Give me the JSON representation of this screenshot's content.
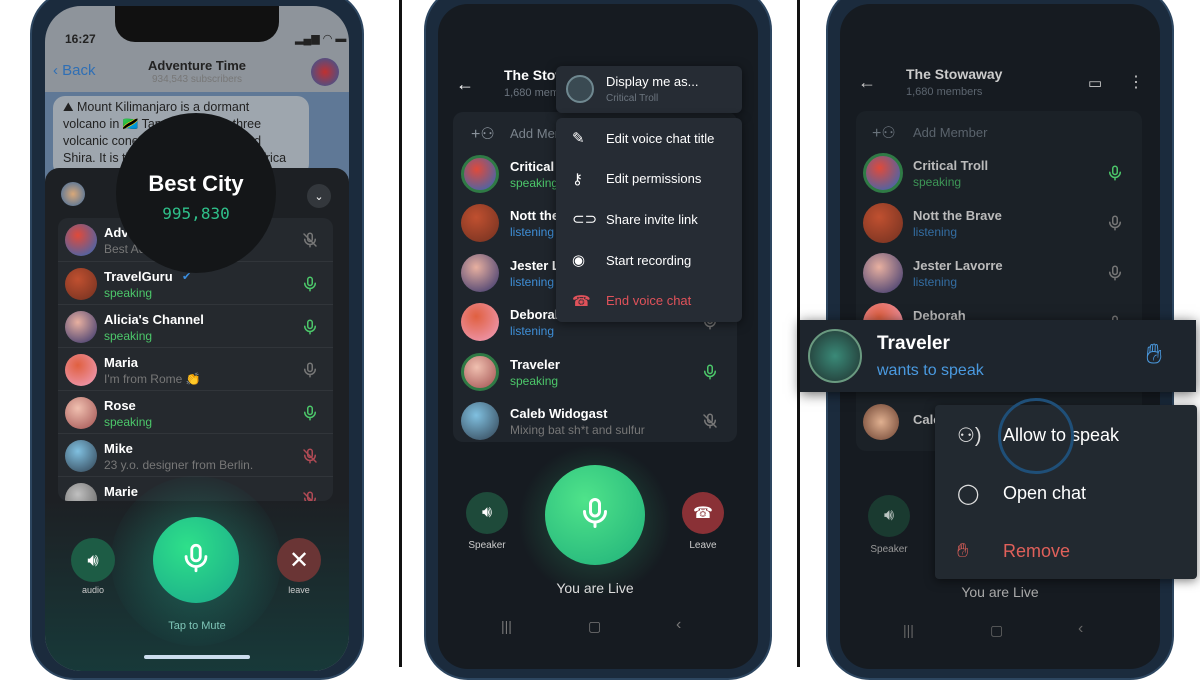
{
  "colors": {
    "green": "#4cc76a",
    "blue": "#3e8ed6",
    "red": "#e0525a",
    "sheet": "#1c1f23",
    "android_bg": "#171c22"
  },
  "panel1": {
    "status_time": "16:27",
    "back_label": "Back",
    "title": "Adventure Time",
    "subtitle": "934,543 subscribers",
    "message_lines": [
      "⛰ Mount Kilimanjaro is a dormant",
      "volcano in 🇹🇿 Tanzania. It has three",
      "volcanic cones: Kibo, Mawenzi, and",
      "Shira. It is the highest mountain in Africa"
    ],
    "tooltip": {
      "title": "Best City",
      "count": "995,830"
    },
    "participants": [
      {
        "name": "Adventure Time",
        "status": "Best Adventures",
        "state": "muted"
      },
      {
        "name": "TravelGuru",
        "status": "speaking",
        "state": "speaking",
        "verified": true
      },
      {
        "name": "Alicia's Channel",
        "status": "speaking",
        "state": "speaking"
      },
      {
        "name": "Maria",
        "status": "I'm from Rome 👏",
        "state": "idle"
      },
      {
        "name": "Rose",
        "status": "speaking",
        "state": "speaking"
      },
      {
        "name": "Mike",
        "status": "23 y.o. designer from Berlin.",
        "state": "muted-red"
      },
      {
        "name": "Marie",
        "status": "",
        "state": "muted-red"
      }
    ],
    "audio_label": "audio",
    "leave_label": "leave",
    "mute_hint": "Tap to Mute"
  },
  "panel2": {
    "title": "The Stowaway",
    "subtitle": "1,680 members",
    "add_member": "Add Member",
    "participants": [
      {
        "name": "Critical Troll",
        "status": "speaking",
        "state": "speaking"
      },
      {
        "name": "Nott the Brave",
        "status": "listening",
        "state": "idle"
      },
      {
        "name": "Jester Lavorre",
        "status": "listening",
        "state": "idle"
      },
      {
        "name": "Deborah",
        "status": "listening",
        "state": "idle"
      },
      {
        "name": "Traveler",
        "status": "speaking",
        "state": "speaking"
      },
      {
        "name": "Caleb Widogast",
        "status": "Mixing bat sh*t and sulfur",
        "state": "muted"
      }
    ],
    "display_as": {
      "label": "Display me as...",
      "value": "Critical Troll"
    },
    "menu": [
      {
        "label": "Edit voice chat title",
        "icon": "pencil-icon"
      },
      {
        "label": "Edit permissions",
        "icon": "key-icon"
      },
      {
        "label": "Share invite link",
        "icon": "link-icon"
      },
      {
        "label": "Start recording",
        "icon": "record-icon"
      },
      {
        "label": "End voice chat",
        "icon": "hangup-icon",
        "danger": true
      }
    ],
    "speaker_label": "Speaker",
    "leave_label": "Leave",
    "live_label": "You are Live"
  },
  "panel3": {
    "title": "The Stowaway",
    "subtitle": "1,680 members",
    "add_member": "Add Member",
    "participants": [
      {
        "name": "Critical Troll",
        "status": "speaking",
        "state": "speaking"
      },
      {
        "name": "Nott the Brave",
        "status": "listening",
        "state": "idle"
      },
      {
        "name": "Jester Lavorre",
        "status": "listening",
        "state": "idle"
      },
      {
        "name": "Deborah",
        "status": "",
        "state": "idle"
      },
      {
        "name": "Caleb Widogast",
        "status": "",
        "state": "muted"
      }
    ],
    "request": {
      "name": "Traveler",
      "status": "wants to speak"
    },
    "menu": [
      {
        "label": "Allow to speak",
        "icon": "allow-speak-icon"
      },
      {
        "label": "Open chat",
        "icon": "chat-bubble-icon"
      },
      {
        "label": "Remove",
        "icon": "hand-icon",
        "danger": true
      }
    ],
    "speaker_label": "Speaker",
    "live_label": "You are Live"
  }
}
